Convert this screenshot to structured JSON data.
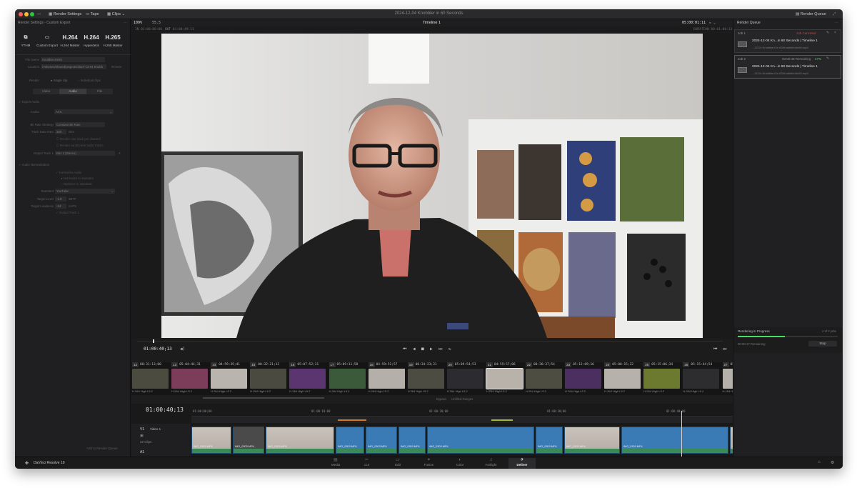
{
  "window": {
    "title": "2024-12-04 Knobbler in 60 Seconds"
  },
  "titlebar": {
    "render_settings": "Render Settings",
    "tape": "Tape",
    "clips": "Clips",
    "render_queue": "Render Queue"
  },
  "left_panel": {
    "header": "Render Settings - Custom Export",
    "presets": [
      {
        "big": "",
        "label": "YTHM"
      },
      {
        "big": "",
        "label": "Custom Export"
      },
      {
        "big": "H.264",
        "label": "H.264 Master"
      },
      {
        "big": "H.264",
        "label": "Hyperdeck"
      },
      {
        "big": "H.265",
        "label": "H.265 Master"
      }
    ],
    "filename_label": "File Name",
    "filename_value": "Knobbler4m60",
    "location_label": "Location",
    "location_value": "/Volumes/shared/projects/2024-12-04 Knobb",
    "browse": "Browse",
    "render_label": "Render",
    "single_clip": "Single clip",
    "individual_clips": "Individual clips",
    "tabs": [
      "Video",
      "Audio",
      "File"
    ],
    "export_audio": "Export Audio",
    "codec_label": "Codec",
    "codec_value": "AAC",
    "bit_rate_label": "Bit Rate Strategy",
    "bit_rate_value": "Constant Bit Rate",
    "track_data_label": "Track Data Rate",
    "track_data_value": "320",
    "track_data_unit": "kb/s",
    "render_track_per_channel": "Render one track per channel",
    "render_discrete_audio": "Render as discrete audio tracks",
    "output_track_label": "Output Track 1",
    "output_track_value": "Bus 1 (Stereo)",
    "audio_norm": "Audio Normalization",
    "normalize_audio": "Normalize Audio",
    "normalize_to_standard": "Normalize to standard",
    "optimize_to_standard": "Optimize to standard",
    "standard_label": "Standard",
    "standard_value": "YouTube",
    "target_level_label": "Target Level",
    "target_level_value": "-1.0",
    "target_level_unit": "dBTP",
    "target_loudness_label": "Target Loudness",
    "target_loudness_value": "-14",
    "target_loudness_unit": "LUFS",
    "output_track_check": "Output Track 1",
    "add_render_queue": "Add to Render Queue"
  },
  "viewer": {
    "zoom": "109%",
    "zoom2": "55.5",
    "timeline_name": "Timeline 1",
    "timecode_right": "05:00:01:11",
    "in_label": "IN",
    "in_tc": "01:00:00:00",
    "out_label": "OUT",
    "out_tc": "01:00:49:13",
    "duration_label": "DURATION",
    "duration_tc": "00:01:00:13",
    "playhead_tc": "01:00:40;13"
  },
  "clips": [
    {
      "num": "12",
      "tc": "00:31:13;00",
      "codec": "H.264 High L5.2",
      "color": "#4b4b40"
    },
    {
      "num": "13",
      "tc": "05:04:44;31",
      "codec": "H.264 High L5.2",
      "color": "#7b3d5a"
    },
    {
      "num": "14",
      "tc": "04:59:39;41",
      "codec": "H.264 High L5.2",
      "color": "#b9b4ae"
    },
    {
      "num": "15",
      "tc": "00:32:21;13",
      "codec": "H.264 High L5.2",
      "color": "#4a4a40"
    },
    {
      "num": "16",
      "tc": "05:07:52;31",
      "codec": "H.264 High L5.2",
      "color": "#5a3570"
    },
    {
      "num": "17",
      "tc": "05:09:11;58",
      "codec": "H.264 High L5.2",
      "color": "#3a5a3a"
    },
    {
      "num": "18",
      "tc": "04:59:51;57",
      "codec": "H.264 High L5.2",
      "color": "#b4afa8"
    },
    {
      "num": "19",
      "tc": "00:34:23;31",
      "codec": "H.264 High L5.2",
      "color": "#4c4c42"
    },
    {
      "num": "20",
      "tc": "05:09:54;53",
      "codec": "H.264 High L5.2",
      "color": "#2c2c30"
    },
    {
      "num": "21",
      "tc": "04:59:57;06",
      "codec": "H.264 High L5.2",
      "color": "#b8b2ab"
    },
    {
      "num": "22",
      "tc": "00:36:37;54",
      "codec": "H.264 High L5.2",
      "color": "#4d4d42"
    },
    {
      "num": "23",
      "tc": "05:12:09;16",
      "codec": "H.264 High L5.2",
      "color": "#4b2f60"
    },
    {
      "num": "24",
      "tc": "05:00:15;32",
      "codec": "H.264 High L5.2",
      "color": "#b6b1aa"
    },
    {
      "num": "25",
      "tc": "05:15:06;34",
      "codec": "H.264 High L5.2",
      "color": "#6b7a2e"
    },
    {
      "num": "26",
      "tc": "05:15:44;54",
      "codec": "H.264 High L5.2",
      "color": "#2d2d30"
    },
    {
      "num": "27",
      "tc": "05:00:30;27",
      "codec": "H.264 High L5.2",
      "color": "#b5b0a9"
    },
    {
      "num": "28",
      "tc": "00:41:05;09",
      "codec": "H.264 High L5.2",
      "color": "#4a4a40"
    },
    {
      "num": "29",
      "tc": "05:16:36;31",
      "codec": "H.264 High L5.2",
      "color": "#2a3a6a"
    }
  ],
  "strip_controls": {
    "bypass": "Bypass",
    "unfilled": "Unfilled Ranges"
  },
  "timeline": {
    "tc": "01:00:40;13",
    "track_v1": "V1",
    "track_v1_name": "Video 1",
    "track_clips": "22 Clips",
    "track_a1": "A1",
    "ruler": [
      "01:00:00;00",
      "01:00:10;00",
      "01:00:20;00",
      "01:00:30;00",
      "01:00:40;00",
      "01:00:50;00"
    ],
    "clip_names": [
      "IMG_0303.MP4",
      "IMG_0303.MP4",
      "IMG_0303.MP4",
      "IMG_0303.MP4",
      "IMG_0303.MP4",
      "IMG_0303.MP4",
      "IMG_0303.MP4",
      "IMG_0303.MP4",
      "IMG_0303.MP4",
      "IMG_0303.MP4",
      "IMG_0303.MP4",
      "IMG_0303.MP4"
    ]
  },
  "render_queue": {
    "title": "Render Queue",
    "job1_label": "Job 1",
    "job1_status": "Job Canceled",
    "job1_name": "2024-12-04 Kn...in 60 Seconds | Timeline 1",
    "job1_path": "...12-04 Knobbler4 in 60/Knobbler4m60.mp4",
    "job2_label": "Job 2",
    "job2_remaining": "00:00:48 Remaining",
    "job2_percent": "47%",
    "job2_name": "2024-12-04 Kn...in 60 Seconds | Timeline 1",
    "job2_path": "...12-04 Knobbler4 in 60/Knobbler4m60.mp4",
    "progress_label": "Rendering in Progress",
    "progress_count": "2 of 2 jobs",
    "progress_fraction": 0.47,
    "remaining_label": "00:00:17 Remaining",
    "stop": "Stop"
  },
  "bottombar": {
    "app_name": "DaVinci Resolve 19",
    "pages": [
      {
        "icon": "▤",
        "label": "Media"
      },
      {
        "icon": "✂",
        "label": "Cut"
      },
      {
        "icon": "▭",
        "label": "Edit"
      },
      {
        "icon": "✦",
        "label": "Fusion"
      },
      {
        "icon": "◐",
        "label": "Color"
      },
      {
        "icon": "♫",
        "label": "Fairlight"
      },
      {
        "icon": "✈",
        "label": "Deliver"
      }
    ],
    "active_page": "Deliver"
  }
}
